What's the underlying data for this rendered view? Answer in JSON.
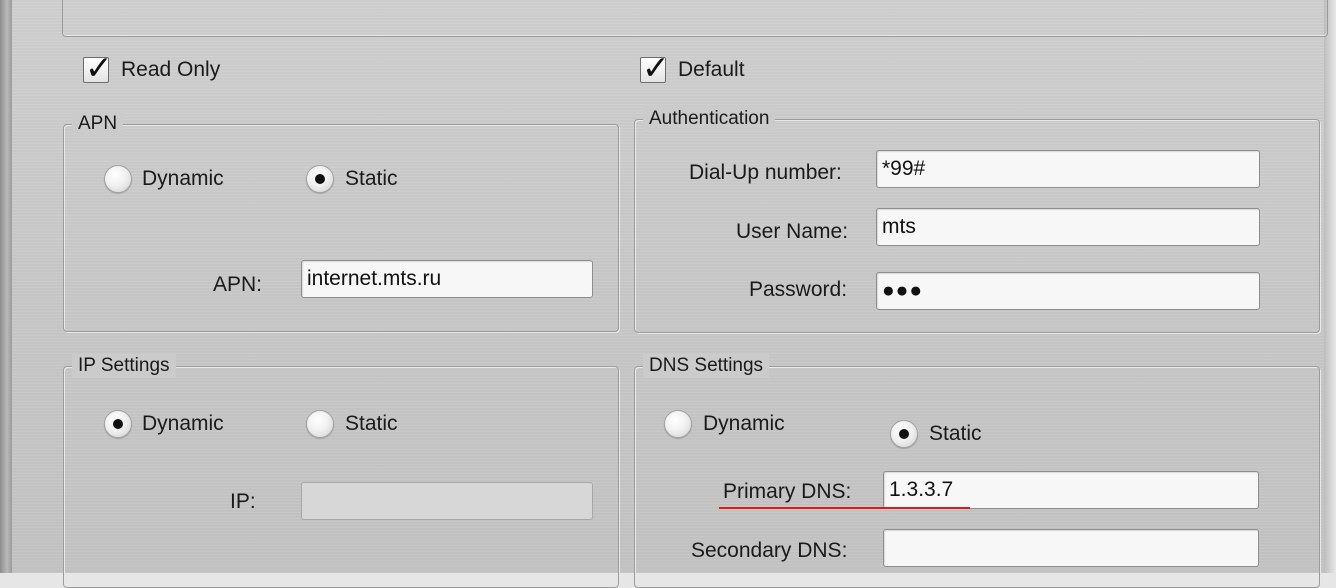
{
  "read_only": {
    "label": "Read Only",
    "checked": true
  },
  "default": {
    "label": "Default",
    "checked": true
  },
  "apn_group": {
    "legend": "APN",
    "dynamic_label": "Dynamic",
    "static_label": "Static",
    "selected": "Static",
    "apn_label": "APN:",
    "apn_value": "internet.mts.ru"
  },
  "auth_group": {
    "legend": "Authentication",
    "dialup_label": "Dial-Up number:",
    "dialup_value": "*99#",
    "username_label": "User Name:",
    "username_value": "mts",
    "password_label": "Password:",
    "password_value": "●●●"
  },
  "ip_group": {
    "legend": "IP Settings",
    "dynamic_label": "Dynamic",
    "static_label": "Static",
    "selected": "Dynamic",
    "ip_label": "IP:",
    "ip_value": ""
  },
  "dns_group": {
    "legend": "DNS Settings",
    "dynamic_label": "Dynamic",
    "static_label": "Static",
    "selected": "Static",
    "primary_label": "Primary DNS:",
    "primary_value": "1.3.3.7",
    "secondary_label": "Secondary DNS:",
    "secondary_value": ""
  },
  "colors": {
    "annotation_underline": "#e01919"
  }
}
